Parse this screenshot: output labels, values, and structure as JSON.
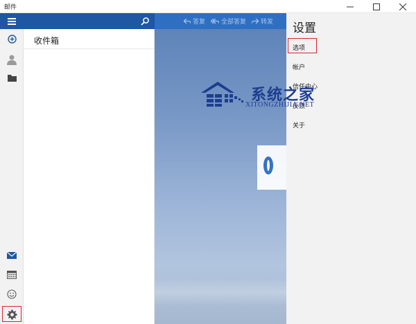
{
  "window": {
    "title": "邮件",
    "controls": {
      "minimize": "—",
      "maximize": "☐",
      "close": "✕"
    }
  },
  "rail": {
    "items": [
      {
        "name": "menu",
        "icon": "hamburger-icon"
      },
      {
        "name": "new-mail",
        "icon": "plus-circle-icon"
      },
      {
        "name": "accounts",
        "icon": "person-icon"
      },
      {
        "name": "folders",
        "icon": "folder-icon"
      },
      {
        "name": "mail",
        "icon": "envelope-icon"
      },
      {
        "name": "calendar",
        "icon": "calendar-icon"
      },
      {
        "name": "feedback",
        "icon": "smiley-icon"
      },
      {
        "name": "settings",
        "icon": "gear-icon",
        "highlighted": true
      }
    ]
  },
  "folder": {
    "title": "收件箱",
    "search_icon": "search-icon"
  },
  "reading": {
    "toolbar": {
      "reply": "答复",
      "reply_all": "全部答复",
      "forward": "转发"
    }
  },
  "settings": {
    "title": "设置",
    "items": [
      "选项",
      "帐户",
      "信任中心",
      "反馈",
      "关于"
    ],
    "highlighted_index": 0
  },
  "watermark": {
    "title": "系统之家",
    "subtitle": "XITONGZHIJIA.NET"
  },
  "colors": {
    "accent": "#1f57a3",
    "toolbar": "#2e6fc2",
    "highlight": "#d9232a",
    "pane_bg": "#f2f2f2"
  }
}
